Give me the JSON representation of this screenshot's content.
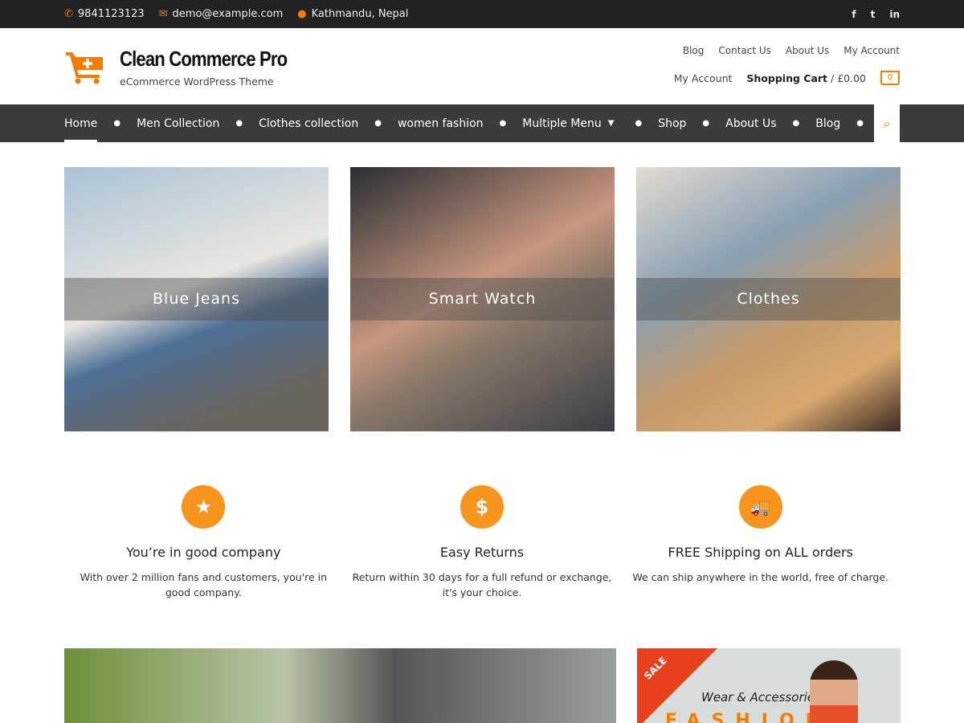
{
  "topbar": {
    "phone": "9841123123",
    "email": "demo@example.com",
    "location": "Kathmandu, Nepal",
    "social": [
      "f",
      "t",
      "in"
    ]
  },
  "header": {
    "title": "Clean Commerce Pro",
    "tagline": "eCommerce WordPress Theme",
    "links": [
      "Blog",
      "Contact Us",
      "About Us",
      "My Account"
    ],
    "my_account": "My Account",
    "cart_label": "Shopping Cart",
    "cart_total": "/ £0.00",
    "cart_count": "0"
  },
  "nav": {
    "items": [
      "Home",
      "Men Collection",
      "Clothes collection",
      "women fashion",
      "Multiple Menu",
      "Shop",
      "About Us",
      "Blog"
    ]
  },
  "tiles": [
    "Blue Jeans",
    "Smart Watch",
    "Clothes"
  ],
  "features": [
    {
      "icon": "★",
      "title": "You’re in good company",
      "text": "With over 2 million fans and customers, you're in good company."
    },
    {
      "icon": "$",
      "title": "Easy Returns",
      "text": "Return within 30 days for a full refund or exchange, it's your choice."
    },
    {
      "icon": "🚚",
      "title": "FREE Shipping on ALL orders",
      "text": "We can ship anywhere in the world, free of charge."
    }
  ],
  "banner": {
    "sale": "SALE",
    "subtitle": "Wear & Accessories",
    "title": "FASHION"
  }
}
